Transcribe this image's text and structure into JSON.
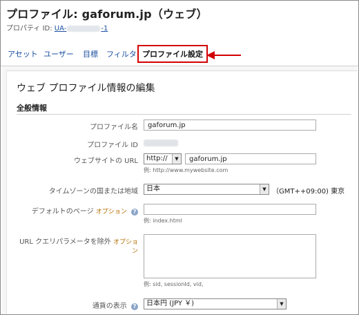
{
  "header": {
    "title": "プロファイル: gaforum.jp（ウェブ）",
    "property_label": "プロパティ ID:",
    "property_id_prefix": "UA-",
    "property_id_suffix": "-1"
  },
  "tabs": [
    {
      "label": "アセット"
    },
    {
      "label": "ユーザー"
    },
    {
      "label": "目標"
    },
    {
      "label": "フィルタ"
    },
    {
      "label": "プロファイル設定",
      "active": true
    }
  ],
  "page": {
    "section_title": "ウェブ プロファイル情報の編集",
    "general_title": "全般情報"
  },
  "form": {
    "profile_name": {
      "label": "プロファイル名",
      "value": "gaforum.jp"
    },
    "profile_id": {
      "label": "プロファイル ID"
    },
    "website_url": {
      "label": "ウェブサイトの URL",
      "protocol": "http://",
      "value": "gaforum.jp",
      "hint": "例: http://www.mywebsite.com"
    },
    "timezone": {
      "label": "タイムゾーンの国または地域",
      "country": "日本",
      "zone": "（GMT++09:00) 東京"
    },
    "default_page": {
      "label": "デフォルトのページ",
      "optional": "オプション",
      "help": "?",
      "value": "",
      "hint": "例: index.html"
    },
    "exclude_params": {
      "label": "URL クエリパラメータを除外",
      "optional": "オプション",
      "value": "",
      "hint": "例: sid, sessionId, vid,"
    },
    "currency": {
      "label": "通貨の表示",
      "help": "?",
      "value": "日本円 (JPY ￥)"
    }
  },
  "colors": {
    "highlight": "#d20000",
    "link": "#1a4fa0"
  }
}
